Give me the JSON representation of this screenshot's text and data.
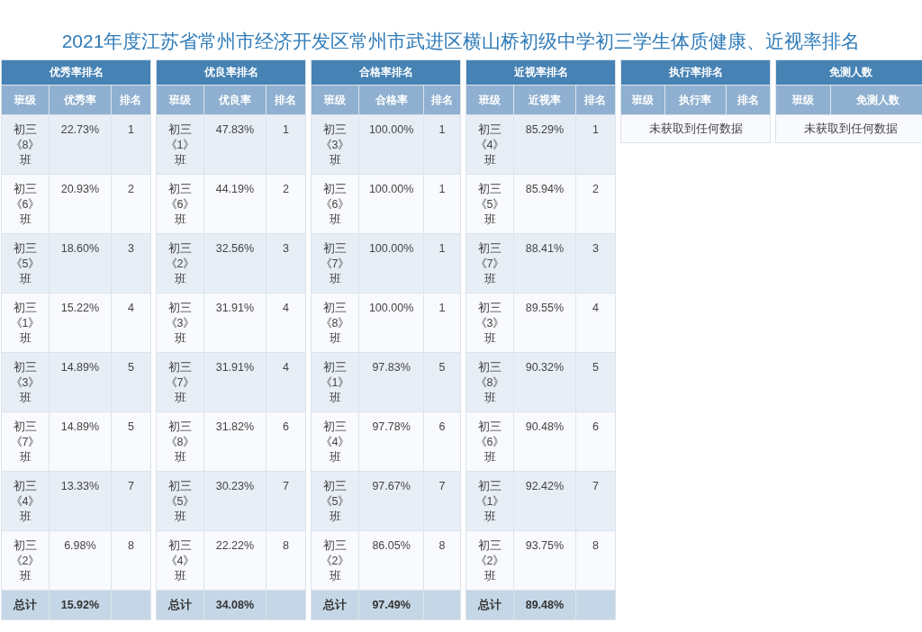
{
  "title": "2021年度江苏省常州市经济开发区常州市武进区横山桥初级中学初三学生体质健康、近视率排名",
  "panels": [
    {
      "title": "优秀率排名",
      "columns": [
        "班级",
        "优秀率",
        "排名"
      ],
      "rows": [
        [
          "初三《8》班",
          "22.73%",
          "1"
        ],
        [
          "初三《6》班",
          "20.93%",
          "2"
        ],
        [
          "初三《5》班",
          "18.60%",
          "3"
        ],
        [
          "初三《1》班",
          "15.22%",
          "4"
        ],
        [
          "初三《3》班",
          "14.89%",
          "5"
        ],
        [
          "初三《7》班",
          "14.89%",
          "5"
        ],
        [
          "初三《4》班",
          "13.33%",
          "7"
        ],
        [
          "初三《2》班",
          "6.98%",
          "8"
        ]
      ],
      "total": {
        "label": "总计",
        "value": "15.92%"
      }
    },
    {
      "title": "优良率排名",
      "columns": [
        "班级",
        "优良率",
        "排名"
      ],
      "rows": [
        [
          "初三《1》班",
          "47.83%",
          "1"
        ],
        [
          "初三《6》班",
          "44.19%",
          "2"
        ],
        [
          "初三《2》班",
          "32.56%",
          "3"
        ],
        [
          "初三《3》班",
          "31.91%",
          "4"
        ],
        [
          "初三《7》班",
          "31.91%",
          "4"
        ],
        [
          "初三《8》班",
          "31.82%",
          "6"
        ],
        [
          "初三《5》班",
          "30.23%",
          "7"
        ],
        [
          "初三《4》班",
          "22.22%",
          "8"
        ]
      ],
      "total": {
        "label": "总计",
        "value": "34.08%"
      }
    },
    {
      "title": "合格率排名",
      "columns": [
        "班级",
        "合格率",
        "排名"
      ],
      "rows": [
        [
          "初三《3》班",
          "100.00%",
          "1"
        ],
        [
          "初三《6》班",
          "100.00%",
          "1"
        ],
        [
          "初三《7》班",
          "100.00%",
          "1"
        ],
        [
          "初三《8》班",
          "100.00%",
          "1"
        ],
        [
          "初三《1》班",
          "97.83%",
          "5"
        ],
        [
          "初三《4》班",
          "97.78%",
          "6"
        ],
        [
          "初三《5》班",
          "97.67%",
          "7"
        ],
        [
          "初三《2》班",
          "86.05%",
          "8"
        ]
      ],
      "total": {
        "label": "总计",
        "value": "97.49%"
      }
    },
    {
      "title": "近视率排名",
      "columns": [
        "班级",
        "近视率",
        "排名"
      ],
      "rows": [
        [
          "初三《4》班",
          "85.29%",
          "1"
        ],
        [
          "初三《5》班",
          "85.94%",
          "2"
        ],
        [
          "初三《7》班",
          "88.41%",
          "3"
        ],
        [
          "初三《3》班",
          "89.55%",
          "4"
        ],
        [
          "初三《8》班",
          "90.32%",
          "5"
        ],
        [
          "初三《6》班",
          "90.48%",
          "6"
        ],
        [
          "初三《1》班",
          "92.42%",
          "7"
        ],
        [
          "初三《2》班",
          "93.75%",
          "8"
        ]
      ],
      "total": {
        "label": "总计",
        "value": "89.48%"
      }
    },
    {
      "title": "执行率排名",
      "columns": [
        "班级",
        "执行率",
        "排名"
      ],
      "empty_message": "未获取到任何数据"
    },
    {
      "title": "免测人数",
      "columns": [
        "班级",
        "免测人数"
      ],
      "empty_message": "未获取到任何数据"
    }
  ]
}
